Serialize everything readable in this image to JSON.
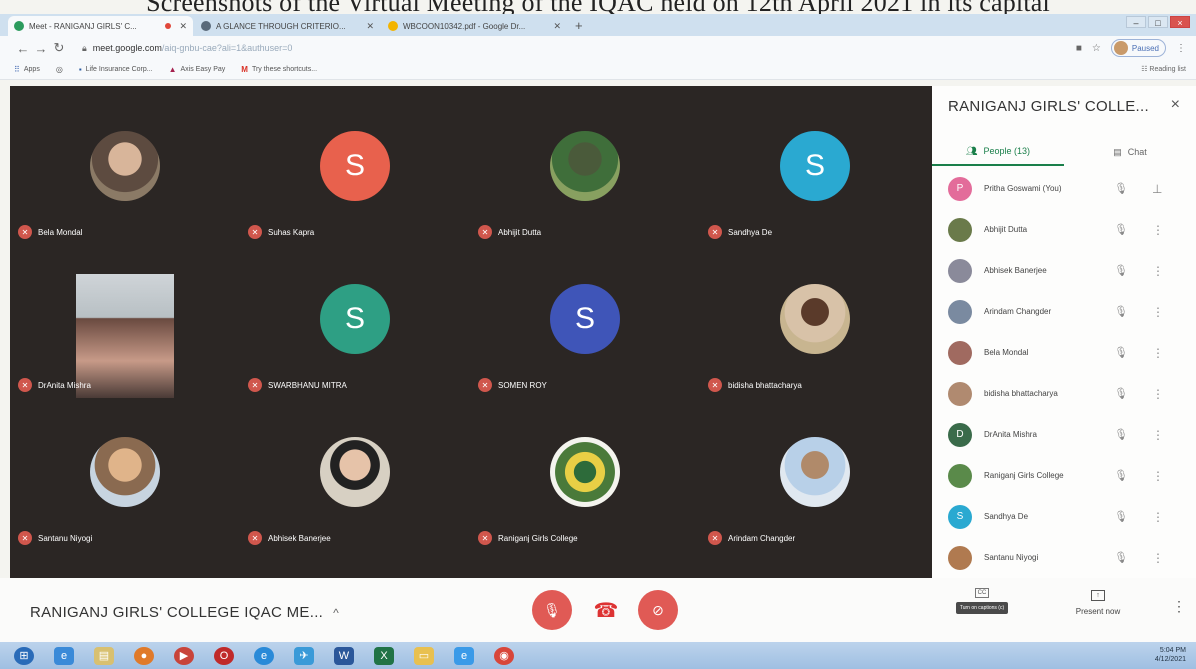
{
  "document": {
    "caption": "Screenshots of the Virtual Meeting of the IQAC held on 12th April 2021 in its capital"
  },
  "browser": {
    "tabs": [
      {
        "title": "Meet - RANIGANJ GIRLS' C...",
        "active": true,
        "favicon_color": "#2b9b5d"
      },
      {
        "title": "A GLANCE THROUGH CRITERIO...",
        "active": false,
        "favicon_color": "#5a6a7a"
      },
      {
        "title": "WBCOON10342.pdf - Google Dr...",
        "active": false,
        "favicon_color": "#f3b400"
      }
    ],
    "new_tab": "+",
    "window_controls": [
      "–",
      "□",
      "×"
    ],
    "url_host": "meet.google.com",
    "url_path": "/aiq-gnbu-cae?ali=1&authuser=0",
    "profile_status": "Paused",
    "bookmarks": [
      {
        "icon": "apps-icon",
        "glyph": "⠿",
        "label": "Apps"
      },
      {
        "icon": "globe-icon",
        "glyph": "◎",
        "label": ""
      },
      {
        "icon": "insurance-icon",
        "glyph": "▪",
        "label": "Life Insurance Corp..."
      },
      {
        "icon": "axis-icon",
        "glyph": "▲",
        "label": "Axis Easy Pay"
      },
      {
        "icon": "gmail-icon",
        "glyph": "M",
        "label": "Try these shortcuts..."
      }
    ],
    "reading_list": "Reading list"
  },
  "meet": {
    "tiles": [
      {
        "name": "Bela Mondal",
        "kind": "photo",
        "style": ""
      },
      {
        "name": "Suhas Kapra",
        "kind": "letter",
        "letter": "S",
        "color": "#e8614d"
      },
      {
        "name": "Abhijit Dutta",
        "kind": "photo",
        "style": "g"
      },
      {
        "name": "Sandhya De",
        "kind": "letter",
        "letter": "S",
        "color": "#2aa9d1"
      },
      {
        "name": "DrAnita Mishra",
        "kind": "video"
      },
      {
        "name": "SWARBHANU MITRA",
        "kind": "letter",
        "letter": "S",
        "color": "#2e9f84"
      },
      {
        "name": "SOMEN ROY",
        "kind": "letter",
        "letter": "S",
        "color": "#3f55b8"
      },
      {
        "name": "bidisha bhattacharya",
        "kind": "photo",
        "style": "br"
      },
      {
        "name": "Santanu Niyogi",
        "kind": "photo",
        "style": "s"
      },
      {
        "name": "Abhisek Banerjee",
        "kind": "photo",
        "style": "b"
      },
      {
        "name": "Raniganj Girls College",
        "kind": "photo",
        "style": "l"
      },
      {
        "name": "Arindam Changder",
        "kind": "photo",
        "style": "w"
      }
    ],
    "panel": {
      "title": "RANIGANJ GIRLS' COLLE...",
      "close": "×",
      "people_tab": "People (13)",
      "chat_tab": "Chat",
      "people": [
        {
          "name": "Pritha Goswami (You)",
          "avatar": "P",
          "color": "#e36c9a"
        },
        {
          "name": "Abhijit Dutta",
          "avatar": "",
          "color": "#6a7a4a"
        },
        {
          "name": "Abhisek Banerjee",
          "avatar": "",
          "color": "#8a8a9a"
        },
        {
          "name": "Arindam Changder",
          "avatar": "",
          "color": "#7a8aa0"
        },
        {
          "name": "Bela Mondal",
          "avatar": "",
          "color": "#a06a60"
        },
        {
          "name": "bidisha bhattacharya",
          "avatar": "",
          "color": "#b08a70"
        },
        {
          "name": "DrAnita Mishra",
          "avatar": "D",
          "color": "#3a6b4a"
        },
        {
          "name": "Raniganj Girls College",
          "avatar": "",
          "color": "#5a8a4a"
        },
        {
          "name": "Sandhya De",
          "avatar": "S",
          "color": "#2aa9d1"
        },
        {
          "name": "Santanu Niyogi",
          "avatar": "",
          "color": "#b07a50"
        }
      ]
    },
    "bottom": {
      "meeting_name": "RANIGANJ GIRLS' COLLEGE IQAC ME...",
      "caret": "^",
      "captions_label": "CC",
      "captions_tip": "Turn on captions (c)",
      "present": "Present now",
      "more": "⋮"
    }
  },
  "taskbar": {
    "apps": [
      "start",
      "ie",
      "files",
      "firefox",
      "media",
      "opera",
      "edge",
      "bird",
      "word",
      "excel",
      "folder",
      "ie2",
      "chrome"
    ],
    "time": "5:04 PM",
    "date": "4/12/2021"
  }
}
